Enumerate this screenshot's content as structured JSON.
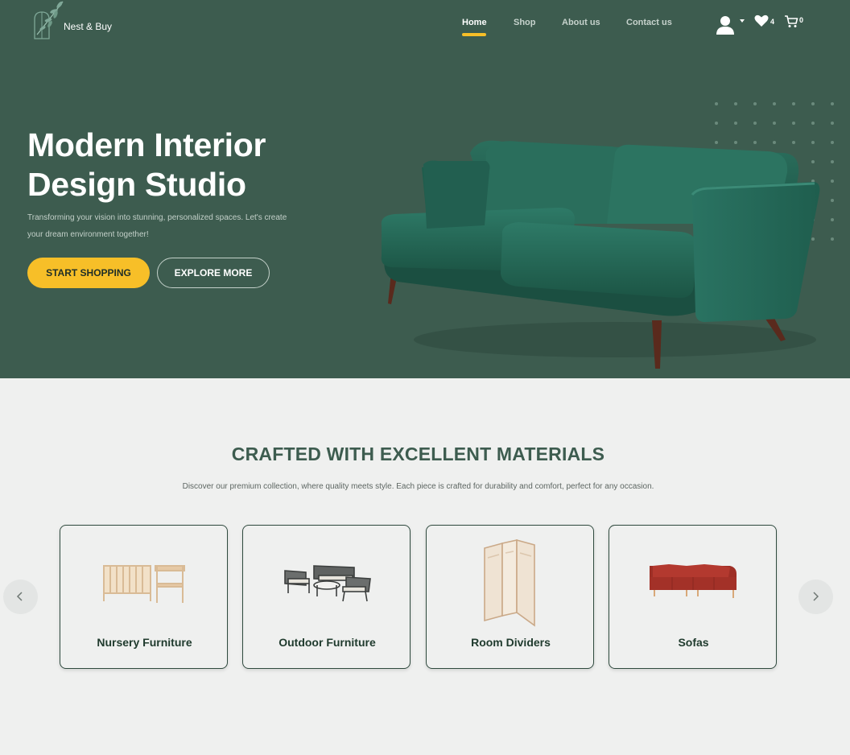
{
  "brand": {
    "name": "Nest & Buy"
  },
  "nav": {
    "items": [
      {
        "label": "Home",
        "active": true
      },
      {
        "label": "Shop",
        "active": false
      },
      {
        "label": "About us",
        "active": false
      },
      {
        "label": "Contact us",
        "active": false
      }
    ]
  },
  "header_icons": {
    "user": "user-icon",
    "wishlist": {
      "icon": "heart-icon",
      "count": "4"
    },
    "cart": {
      "icon": "cart-icon",
      "count": "0"
    }
  },
  "hero": {
    "title_line1": "Modern Interior",
    "title_line2": "Design Studio",
    "subtitle": "Transforming your vision into stunning, personalized spaces. Let's create your dream environment together!",
    "primary_button": "START SHOPPING",
    "secondary_button": "EXPLORE MORE"
  },
  "materials": {
    "title": "CRAFTED WITH EXCELLENT MATERIALS",
    "subtitle": "Discover our premium collection, where quality meets style. Each piece is crafted for durability and comfort, perfect for any occasion.",
    "categories": [
      {
        "label": "Nursery Furniture",
        "icon": "crib-image"
      },
      {
        "label": "Outdoor Furniture",
        "icon": "patio-set-image"
      },
      {
        "label": "Room Dividers",
        "icon": "folding-screen-image"
      },
      {
        "label": "Sofas",
        "icon": "red-sofa-image"
      }
    ]
  },
  "colors": {
    "hero_bg": "#3d5c4f",
    "accent": "#f7bf28",
    "page_bg": "#eff0ef",
    "heading": "#3d5c4f",
    "card_text": "#203b2e"
  }
}
